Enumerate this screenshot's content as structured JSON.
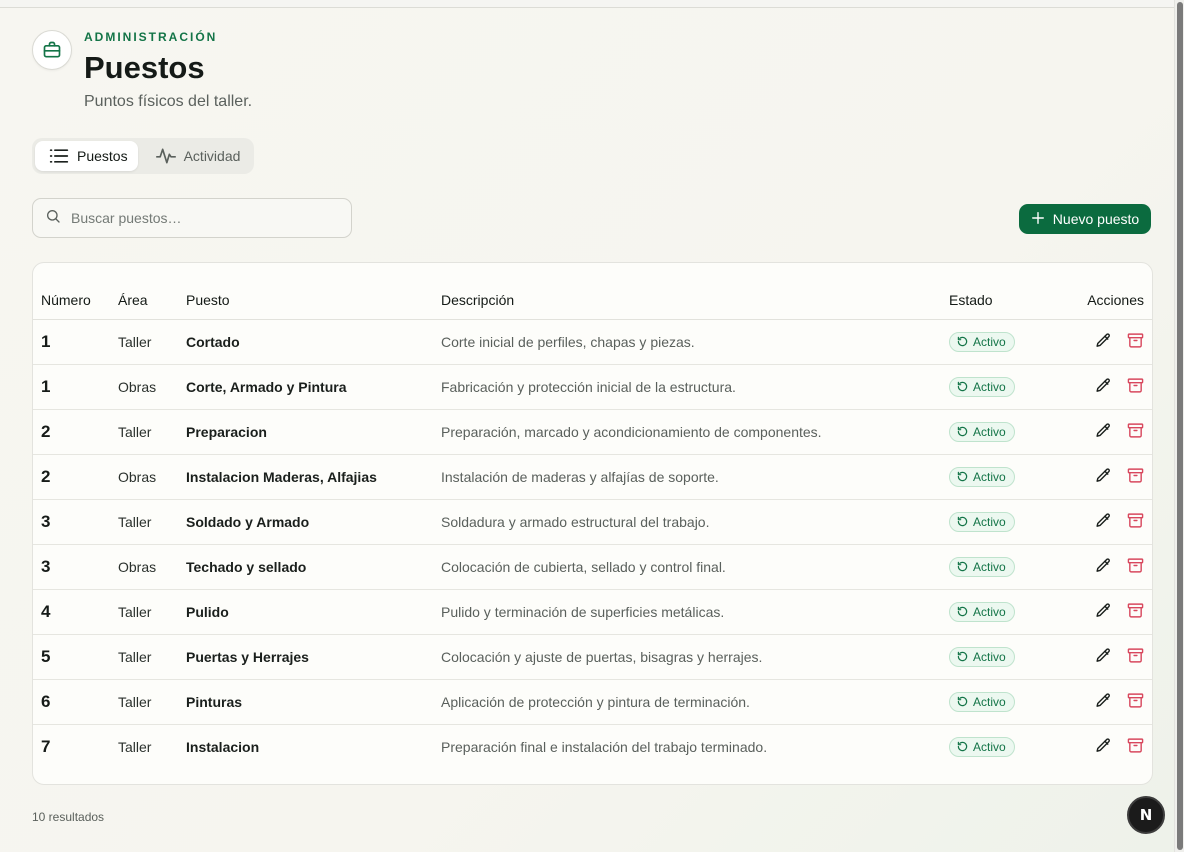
{
  "header": {
    "eyebrow": "ADMINISTRACIÓN",
    "title": "Puestos",
    "subtitle": "Puntos físicos del taller.",
    "icon": "briefcase-icon"
  },
  "tabs": [
    {
      "label": "Puestos",
      "icon": "list-icon",
      "active": true
    },
    {
      "label": "Actividad",
      "icon": "activity-icon",
      "active": false
    }
  ],
  "search": {
    "placeholder": "Buscar puestos…",
    "value": ""
  },
  "new_button": {
    "label": "Nuevo puesto"
  },
  "table": {
    "columns": [
      "Número",
      "Área",
      "Puesto",
      "Descripción",
      "Estado",
      "Acciones"
    ],
    "rows": [
      {
        "numero": "1",
        "area": "Taller",
        "puesto": "Cortado",
        "descripcion": "Corte inicial de perfiles, chapas y piezas.",
        "estado": "Activo"
      },
      {
        "numero": "1",
        "area": "Obras",
        "puesto": "Corte, Armado y Pintura",
        "descripcion": "Fabricación y protección inicial de la estructura.",
        "estado": "Activo"
      },
      {
        "numero": "2",
        "area": "Taller",
        "puesto": "Preparacion",
        "descripcion": "Preparación, marcado y acondicionamiento de componentes.",
        "estado": "Activo"
      },
      {
        "numero": "2",
        "area": "Obras",
        "puesto": "Instalacion Maderas, Alfajias",
        "descripcion": "Instalación de maderas y alfajías de soporte.",
        "estado": "Activo"
      },
      {
        "numero": "3",
        "area": "Taller",
        "puesto": "Soldado y Armado",
        "descripcion": "Soldadura y armado estructural del trabajo.",
        "estado": "Activo"
      },
      {
        "numero": "3",
        "area": "Obras",
        "puesto": "Techado y sellado",
        "descripcion": "Colocación de cubierta, sellado y control final.",
        "estado": "Activo"
      },
      {
        "numero": "4",
        "area": "Taller",
        "puesto": "Pulido",
        "descripcion": "Pulido y terminación de superficies metálicas.",
        "estado": "Activo"
      },
      {
        "numero": "5",
        "area": "Taller",
        "puesto": "Puertas y Herrajes",
        "descripcion": "Colocación y ajuste de puertas, bisagras y herrajes.",
        "estado": "Activo"
      },
      {
        "numero": "6",
        "area": "Taller",
        "puesto": "Pinturas",
        "descripcion": "Aplicación de protección y pintura de terminación.",
        "estado": "Activo"
      },
      {
        "numero": "7",
        "area": "Taller",
        "puesto": "Instalacion",
        "descripcion": "Preparación final e instalación del trabajo terminado.",
        "estado": "Activo"
      }
    ]
  },
  "footer": {
    "results": "10 resultados"
  },
  "dev_badge": {
    "label": "N"
  },
  "colors": {
    "accent": "#0b6b3f",
    "accent_text": "#137447",
    "delete": "#d8485e"
  }
}
